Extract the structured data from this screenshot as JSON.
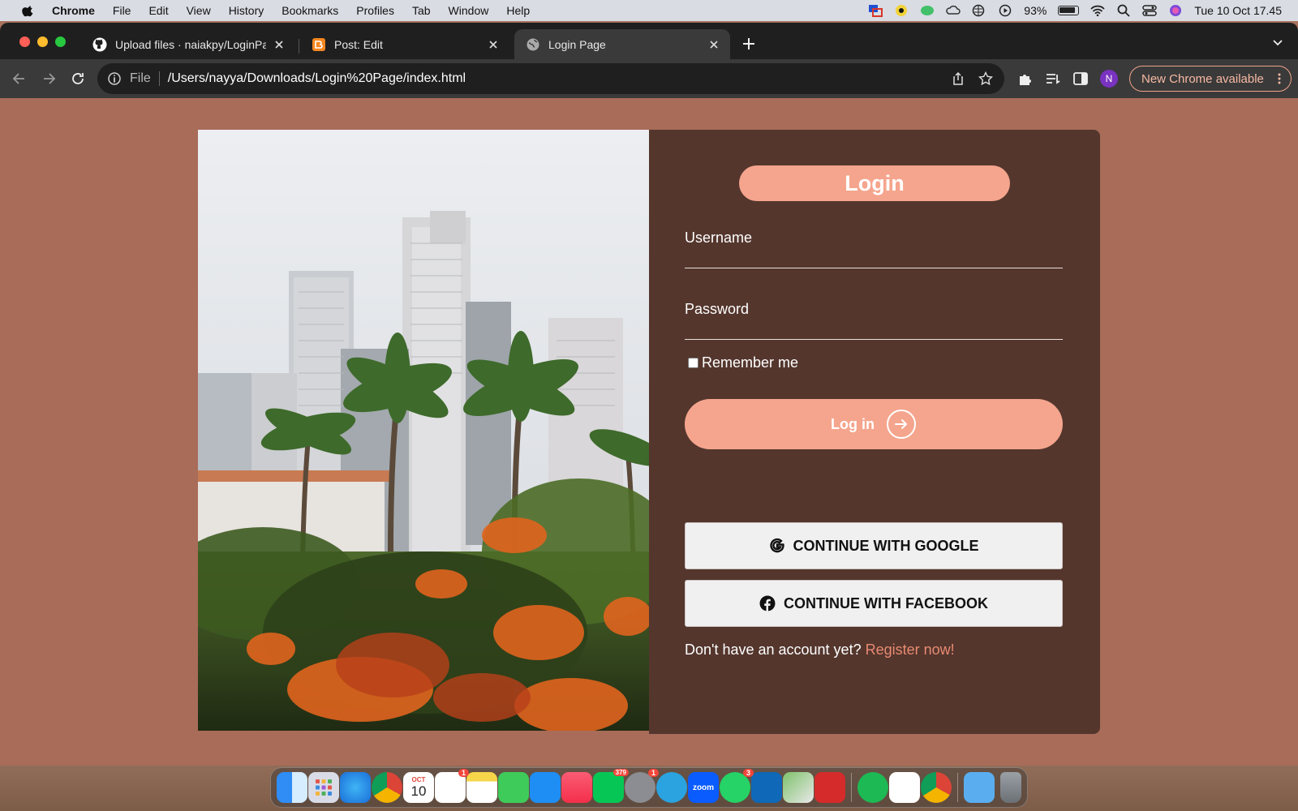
{
  "menubar": {
    "app": "Chrome",
    "items": [
      "File",
      "Edit",
      "View",
      "History",
      "Bookmarks",
      "Profiles",
      "Tab",
      "Window",
      "Help"
    ],
    "battery": "93%",
    "clock": "Tue 10 Oct  17.45"
  },
  "browser": {
    "tabs": [
      {
        "title": "Upload files · naiakpy/LoginPa",
        "icon": "github-icon"
      },
      {
        "title": "Post: Edit",
        "icon": "blogger-icon"
      },
      {
        "title": "Login Page",
        "icon": "globe-icon"
      }
    ],
    "address": {
      "scheme": "File",
      "url": "/Users/nayya/Downloads/Login%20Page/index.html"
    },
    "profile_initial": "N",
    "update_label": "New Chrome available"
  },
  "login": {
    "title": "Login",
    "username_label": "Username",
    "password_label": "Password",
    "remember_label": "Remember me",
    "login_button": "Log in",
    "google_button": "CONTINUE WITH GOOGLE",
    "facebook_button": "CONTINUE WITH FACEBOOK",
    "register_prompt": "Don't have an account yet?",
    "register_link": "Register now!"
  },
  "dock": {
    "calendar_month": "OCT",
    "calendar_day": "10",
    "zoom_label": "zoom",
    "badges": {
      "reminders": "1",
      "line": "379",
      "settings": "1",
      "whatsapp": "3"
    }
  },
  "colors": {
    "page_bg": "#a86c59",
    "card_bg": "#54362d",
    "accent": "#f5a58d",
    "link": "#e98a72"
  }
}
